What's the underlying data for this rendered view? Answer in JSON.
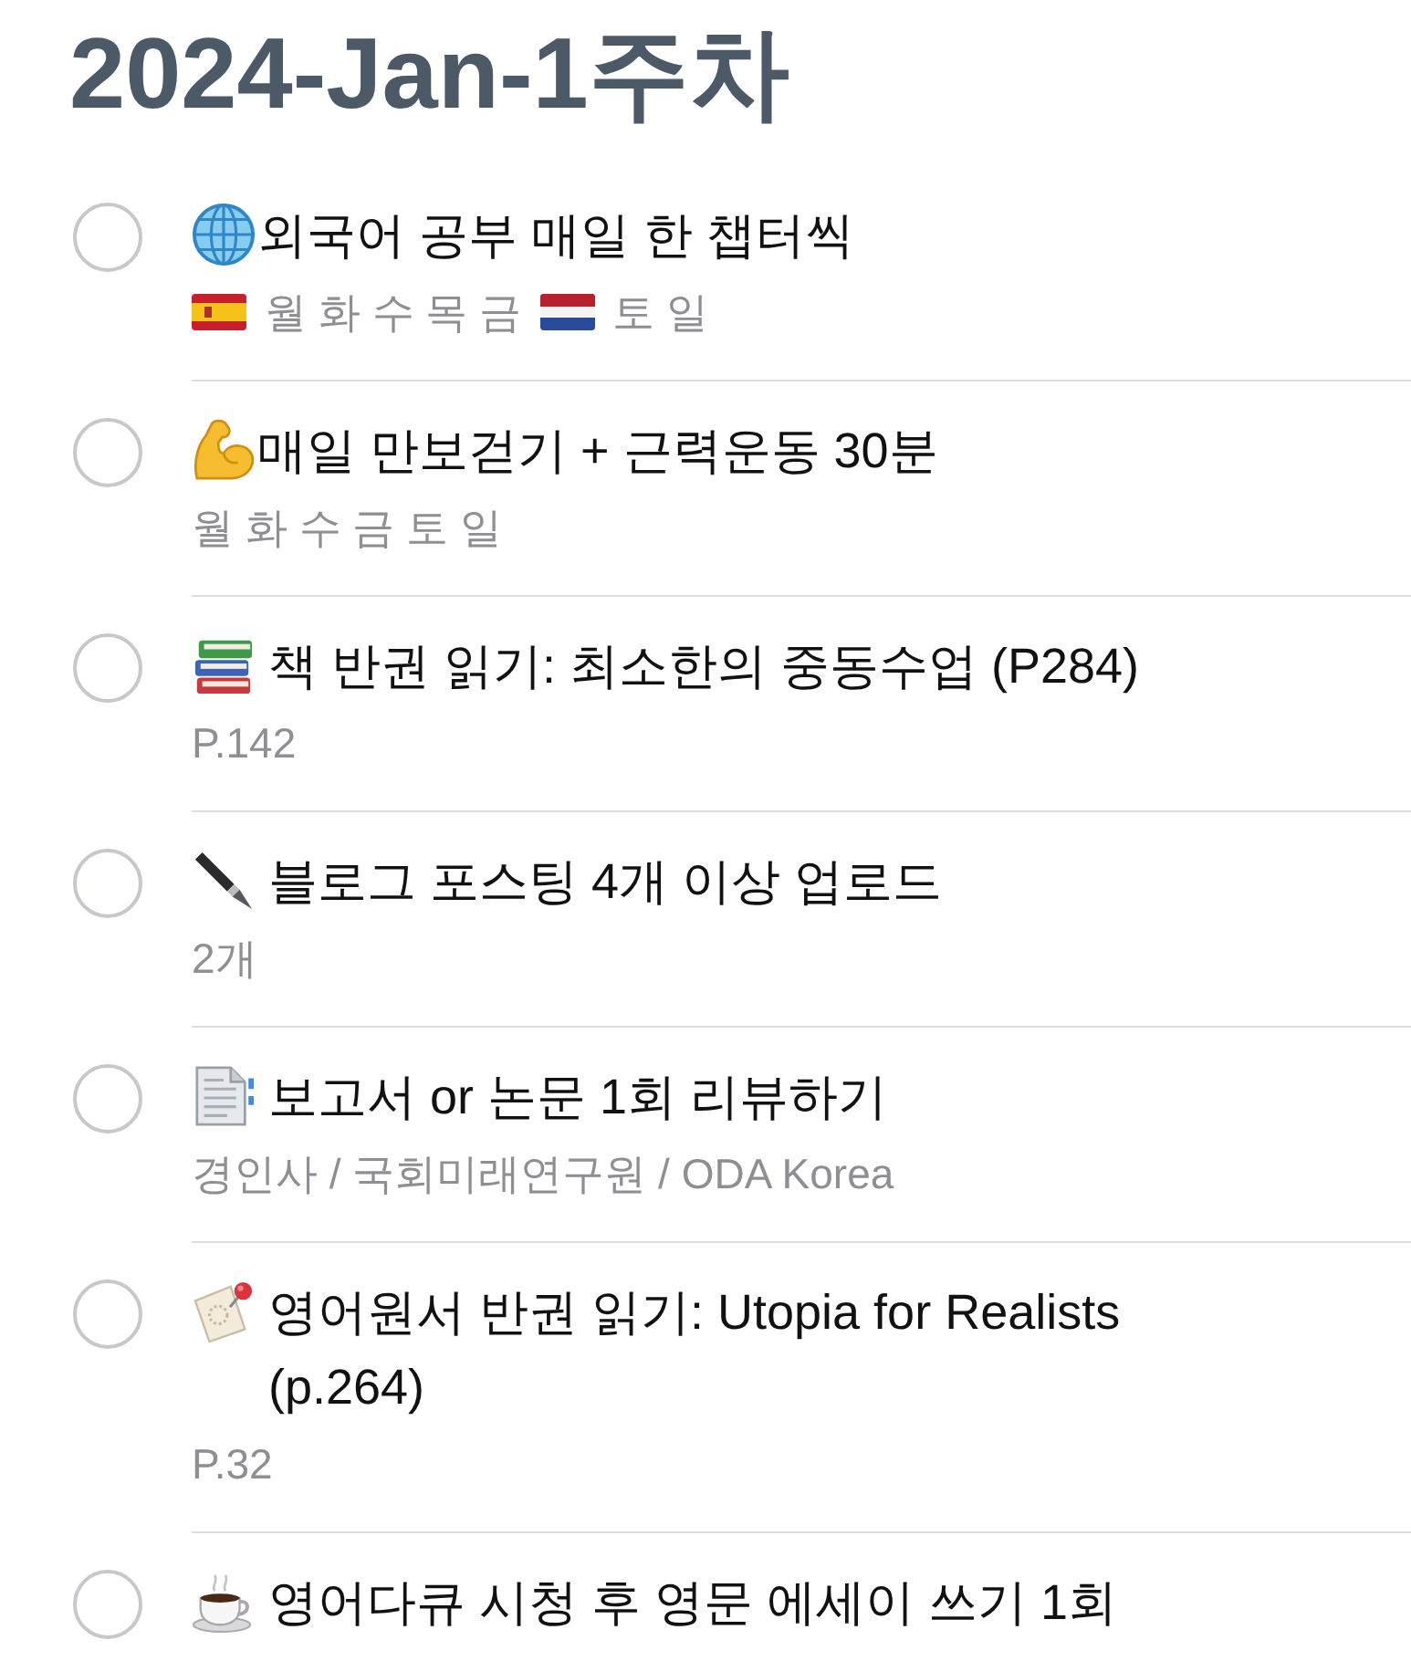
{
  "title": "2024-Jan-1주차",
  "items": [
    {
      "checked": false,
      "title": "외국어 공부 매일 한 챕터씩",
      "note_parts": [
        {
          "kind": "icon"
        },
        {
          "kind": "text",
          "text": "월 화 수 목 금"
        },
        {
          "kind": "icon"
        },
        {
          "kind": "text",
          "text": "토 일"
        }
      ]
    },
    {
      "checked": false,
      "title": "매일 만보걷기 + 근력운동 30분",
      "note_parts": [
        {
          "kind": "text",
          "text": "월 화 수 금 토 일"
        }
      ]
    },
    {
      "checked": false,
      "title": "책 반권 읽기: 최소한의 중동수업 (P284)",
      "note_parts": [
        {
          "kind": "text",
          "text": "P.142"
        }
      ]
    },
    {
      "checked": false,
      "title": "블로그 포스팅 4개 이상 업로드",
      "note_parts": [
        {
          "kind": "text",
          "text": "2개"
        }
      ]
    },
    {
      "checked": false,
      "title": "보고서 or 논문 1회 리뷰하기",
      "note_parts": [
        {
          "kind": "text",
          "text": "경인사 / 국회미래연구원 / ODA Korea"
        }
      ]
    },
    {
      "checked": false,
      "title": "영어원서 반권 읽기: Utopia for Realists (p.264)",
      "note_parts": [
        {
          "kind": "text",
          "text": "P.32"
        }
      ]
    },
    {
      "checked": false,
      "title": "영어다큐 시청 후 영문 에세이 쓰기 1회"
    }
  ]
}
